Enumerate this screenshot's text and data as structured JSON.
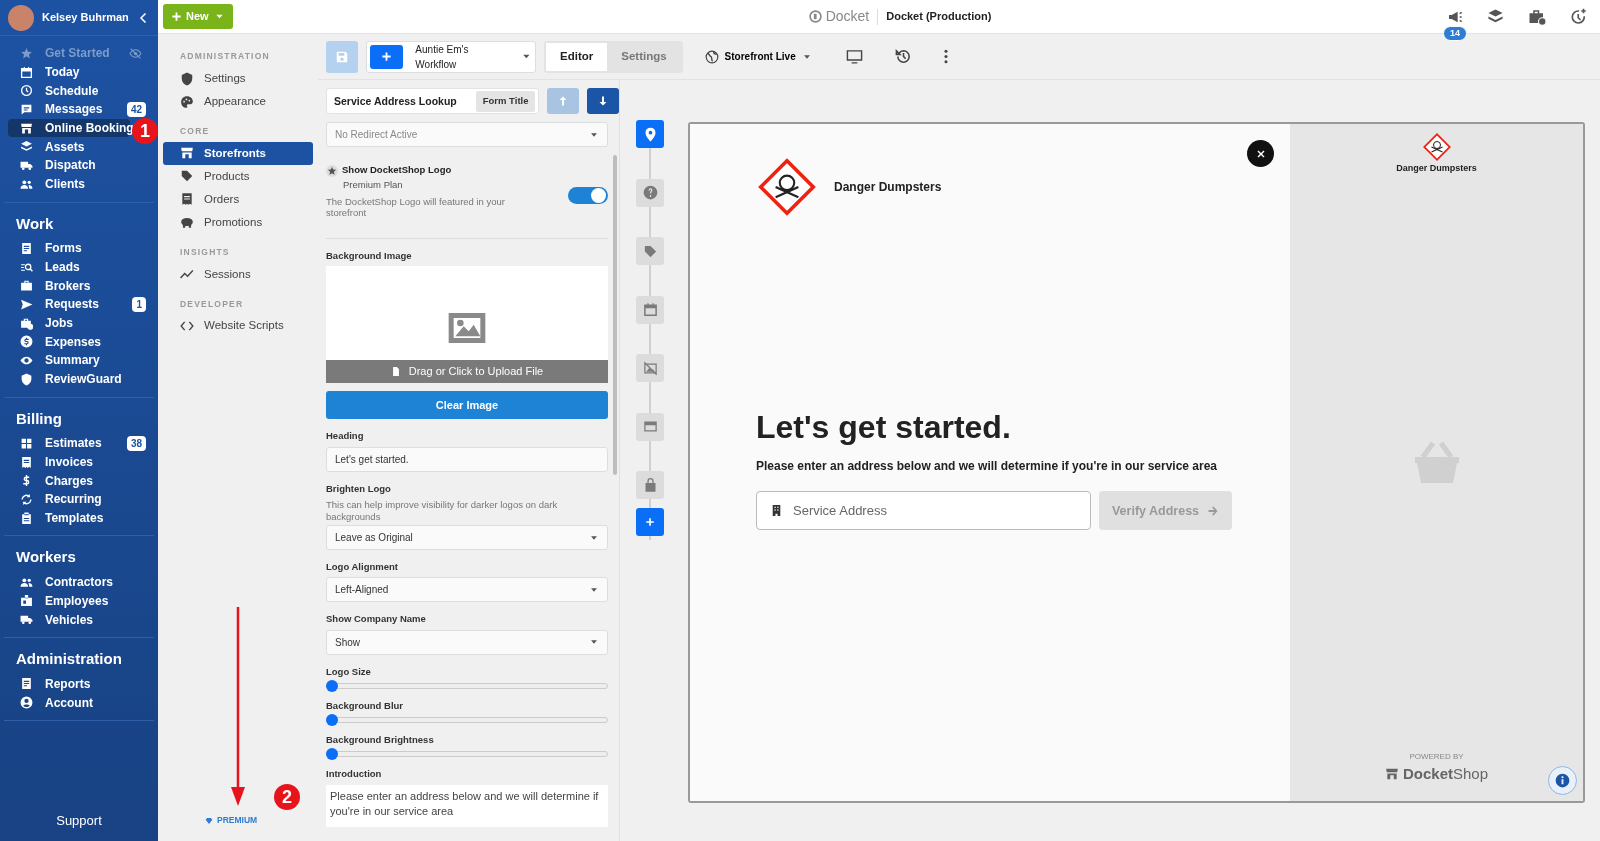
{
  "user": {
    "name": "Kelsey Buhrman"
  },
  "sidebar": {
    "groups": [
      {
        "items": [
          {
            "label": "Get Started",
            "selected": false,
            "disabled": true
          },
          {
            "label": "Today",
            "selected": false,
            "disabled": false
          },
          {
            "label": "Schedule",
            "selected": false,
            "disabled": false
          },
          {
            "label": "Messages",
            "selected": false,
            "disabled": false,
            "badge": "42"
          },
          {
            "label": "Online Booking",
            "selected": true,
            "disabled": false
          },
          {
            "label": "Assets",
            "selected": false,
            "disabled": false
          },
          {
            "label": "Dispatch",
            "selected": false,
            "disabled": false
          },
          {
            "label": "Clients",
            "selected": false,
            "disabled": false
          }
        ]
      },
      {
        "title": "Work",
        "items": [
          {
            "label": "Forms",
            "selected": false,
            "disabled": false
          },
          {
            "label": "Leads",
            "selected": false,
            "disabled": false
          },
          {
            "label": "Brokers",
            "selected": false,
            "disabled": false
          },
          {
            "label": "Requests",
            "selected": false,
            "disabled": false,
            "badge": "1"
          },
          {
            "label": "Jobs",
            "selected": false,
            "disabled": false
          },
          {
            "label": "Expenses",
            "selected": false,
            "disabled": false
          },
          {
            "label": "Summary",
            "selected": false,
            "disabled": false
          },
          {
            "label": "ReviewGuard",
            "selected": false,
            "disabled": false
          }
        ]
      },
      {
        "title": "Billing",
        "items": [
          {
            "label": "Estimates",
            "selected": false,
            "disabled": false,
            "badge": "38"
          },
          {
            "label": "Invoices",
            "selected": false,
            "disabled": false
          },
          {
            "label": "Charges",
            "selected": false,
            "disabled": false
          },
          {
            "label": "Recurring",
            "selected": false,
            "disabled": false
          },
          {
            "label": "Templates",
            "selected": false,
            "disabled": false
          }
        ]
      },
      {
        "title": "Workers",
        "items": [
          {
            "label": "Contractors",
            "selected": false,
            "disabled": false
          },
          {
            "label": "Employees",
            "selected": false,
            "disabled": false
          },
          {
            "label": "Vehicles",
            "selected": false,
            "disabled": false
          }
        ]
      },
      {
        "title": "Administration",
        "items": [
          {
            "label": "Reports",
            "selected": false,
            "disabled": false
          },
          {
            "label": "Account",
            "selected": false,
            "disabled": false
          }
        ]
      }
    ],
    "support": "Support"
  },
  "new_button": {
    "label": "New"
  },
  "app": {
    "logo": "Docket",
    "environment": "Docket (Production)",
    "notification_count": "14"
  },
  "subnav": {
    "sections": [
      {
        "title": "ADMINISTRATION",
        "items": [
          {
            "label": "Settings",
            "selected": false
          },
          {
            "label": "Appearance",
            "selected": false
          }
        ]
      },
      {
        "title": "CORE",
        "items": [
          {
            "label": "Storefronts",
            "selected": true
          },
          {
            "label": "Products",
            "selected": false
          },
          {
            "label": "Orders",
            "selected": false
          },
          {
            "label": "Promotions",
            "selected": false
          }
        ]
      },
      {
        "title": "INSIGHTS",
        "items": [
          {
            "label": "Sessions",
            "selected": false
          }
        ]
      },
      {
        "title": "DEVELOPER",
        "items": [
          {
            "label": "Website Scripts",
            "selected": false
          }
        ]
      }
    ],
    "premium": "PREMIUM"
  },
  "toolbar": {
    "workflow": "Auntie Em's Workflow",
    "tabs": [
      {
        "label": "Editor",
        "selected": true
      },
      {
        "label": "Settings",
        "selected": false
      }
    ],
    "status": "Storefront Live"
  },
  "editor": {
    "title_field": {
      "value": "Service Address Lookup",
      "tag": "Form Title"
    },
    "move_buttons": [
      {
        "kind": "up",
        "disabled": true
      },
      {
        "kind": "down",
        "disabled": false
      }
    ],
    "redirect": "No Redirect Active",
    "logo_toggle": {
      "title": "Show DocketShop Logo",
      "plan": "Premium Plan",
      "description": "The DocketShop Logo will featured in your storefront",
      "on": true
    },
    "fields": [
      {
        "kind": "upload",
        "label": "Background Image",
        "upload": "Drag or Click to Upload File",
        "clear": "Clear Image"
      },
      {
        "kind": "text",
        "label": "Heading",
        "value": "Let's get started."
      },
      {
        "kind": "select",
        "label": "Brighten Logo",
        "help": "This can help improve visibility for darker logos on dark backgrounds",
        "value": "Leave as Original"
      },
      {
        "kind": "select",
        "label": "Logo Alignment",
        "value": "Left-Aligned"
      },
      {
        "kind": "select",
        "label": "Show Company Name",
        "value": "Show"
      },
      {
        "kind": "slider",
        "label": "Logo Size",
        "level": 0
      },
      {
        "kind": "slider",
        "label": "Background Blur",
        "level": 0
      },
      {
        "kind": "slider",
        "label": "Background Brightness",
        "level": 0
      },
      {
        "kind": "textarea",
        "label": "Introduction",
        "value": "Please enter an address below and we will determine if you're in our service area"
      }
    ]
  },
  "steps": [
    {
      "selected": true
    },
    {
      "selected": false
    },
    {
      "selected": false
    },
    {
      "selected": false
    },
    {
      "selected": false
    },
    {
      "selected": false
    },
    {
      "selected": false
    }
  ],
  "preview": {
    "company": "Danger Dumpsters",
    "heading": "Let's get started.",
    "intro": "Please enter an address below and we will determine if you're in our service area",
    "placeholder": "Service Address",
    "verify": {
      "label": "Verify Address",
      "disabled": true
    },
    "side_company": "Danger Dumpsters",
    "powered_by": "POWERED BY",
    "brand": "**Docket**Shop"
  },
  "annotations": [
    {
      "label": "1"
    },
    {
      "label": "2"
    }
  ]
}
